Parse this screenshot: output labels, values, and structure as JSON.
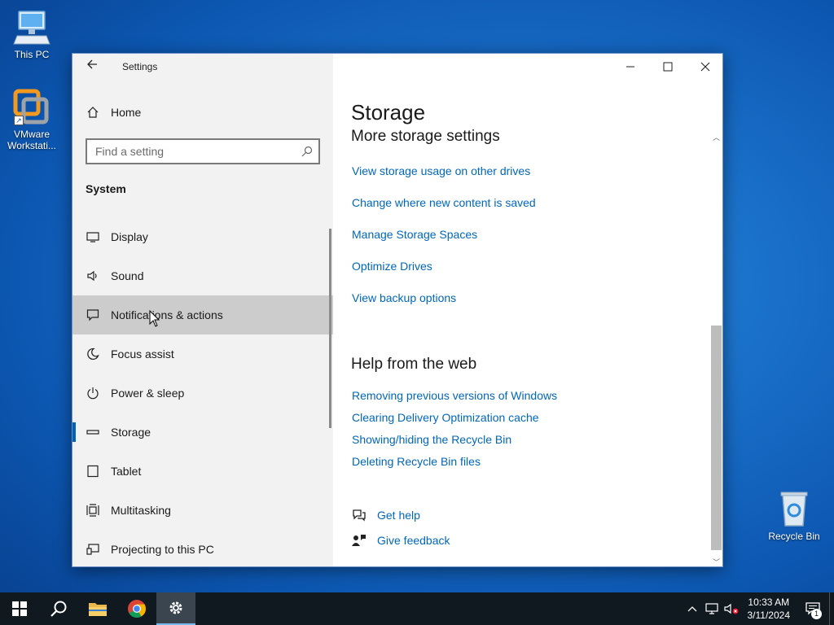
{
  "desktop": {
    "icons": [
      {
        "label": "This PC",
        "icon": "this-pc-icon"
      },
      {
        "label": "VMware Workstati...",
        "icon": "vmware-icon"
      },
      {
        "label": "Recycle Bin",
        "icon": "recycle-bin-icon"
      }
    ]
  },
  "window": {
    "title": "Settings",
    "back_icon": "back-arrow-icon",
    "controls": [
      "minimize",
      "maximize",
      "close"
    ]
  },
  "sidebar": {
    "home_label": "Home",
    "search_placeholder": "Find a setting",
    "section_title": "System",
    "items": [
      {
        "label": "Display",
        "icon": "display-icon"
      },
      {
        "label": "Sound",
        "icon": "sound-icon"
      },
      {
        "label": "Notifications & actions",
        "icon": "notifications-icon",
        "state": "hover"
      },
      {
        "label": "Focus assist",
        "icon": "moon-icon"
      },
      {
        "label": "Power & sleep",
        "icon": "power-icon"
      },
      {
        "label": "Storage",
        "icon": "storage-icon",
        "state": "selected"
      },
      {
        "label": "Tablet",
        "icon": "tablet-icon"
      },
      {
        "label": "Multitasking",
        "icon": "multitasking-icon"
      },
      {
        "label": "Projecting to this PC",
        "icon": "projecting-icon"
      }
    ]
  },
  "content": {
    "page_title": "Storage",
    "more_settings_heading": "More storage settings",
    "more_links": [
      "View storage usage on other drives",
      "Change where new content is saved",
      "Manage Storage Spaces",
      "Optimize Drives",
      "View backup options"
    ],
    "help_heading": "Help from the web",
    "help_links": [
      "Removing previous versions of Windows",
      "Clearing Delivery Optimization cache",
      "Showing/hiding the Recycle Bin",
      "Deleting Recycle Bin files"
    ],
    "get_help": "Get help",
    "give_feedback": "Give feedback"
  },
  "taskbar": {
    "apps": [
      "start",
      "search",
      "file-explorer",
      "chrome",
      "settings"
    ],
    "time": "10:33 AM",
    "date": "3/11/2024",
    "notification_count": "1"
  },
  "colors": {
    "accent": "#0063b1",
    "link": "#0067b8",
    "sidebar_bg": "#f2f2f2",
    "hover_bg": "#cccccc",
    "taskbar_bg": "#101820"
  }
}
